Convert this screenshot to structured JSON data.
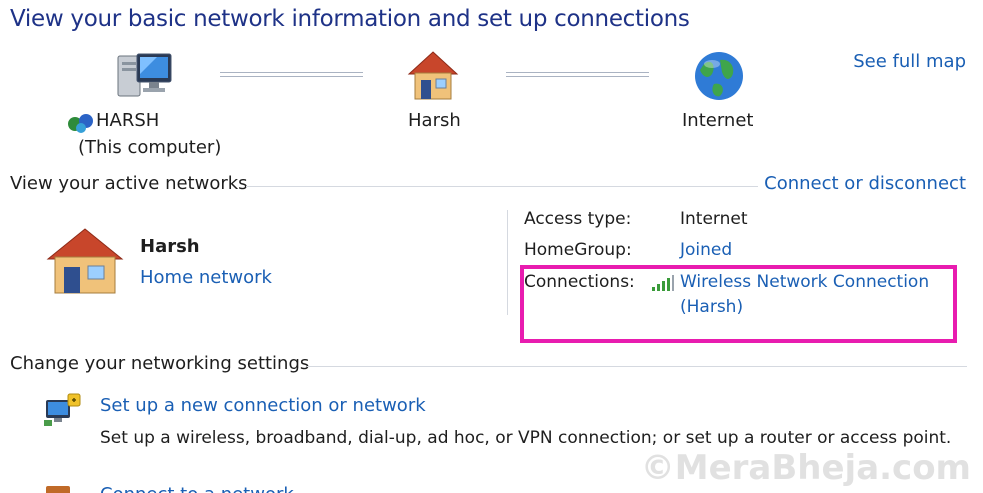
{
  "header": {
    "title": "View your basic network information and set up connections"
  },
  "network_map": {
    "see_full_map": "See full map",
    "computer": {
      "name": "HARSH",
      "subtitle": "(This computer)"
    },
    "network": {
      "name": "Harsh"
    },
    "internet": {
      "name": "Internet"
    }
  },
  "active_networks": {
    "header": "View your active networks",
    "connect_link": "Connect or disconnect",
    "network_name": "Harsh",
    "network_type": "Home network",
    "properties": {
      "access_type_label": "Access type:",
      "access_type_value": "Internet",
      "homegroup_label": "HomeGroup:",
      "homegroup_value": "Joined",
      "connections_label": "Connections:",
      "connections_value_line1": "Wireless Network Connection",
      "connections_value_line2": "(Harsh)"
    }
  },
  "settings": {
    "header": "Change your networking settings",
    "tasks": [
      {
        "label": "Set up a new connection or network",
        "description": "Set up a wireless, broadband, dial-up, ad hoc, or VPN connection; or set up a router or access point."
      },
      {
        "label": "Connect to a network"
      }
    ]
  },
  "watermark": "©MeraBheja.com",
  "colors": {
    "title": "#1e3287",
    "link": "#1a5fb4",
    "highlight": "#e81caf"
  }
}
